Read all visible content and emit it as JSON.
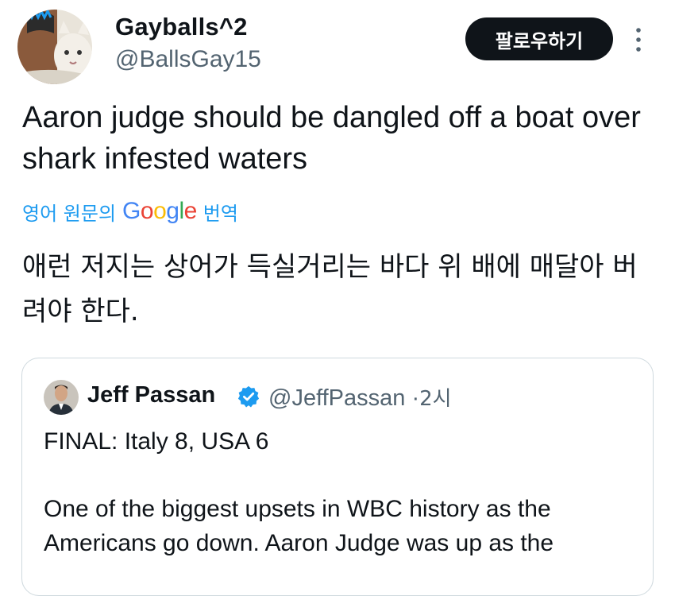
{
  "author": {
    "display_name": "Gayballs^2",
    "handle": "@BallsGay15"
  },
  "follow_button": {
    "label": "팔로우하기"
  },
  "more_icon": "vertical-ellipsis",
  "tweet": {
    "text": "Aaron judge should be dangled off a boat over shark infested waters"
  },
  "translation": {
    "prefix": "영어 원문의",
    "brand": [
      "G",
      "o",
      "o",
      "g",
      "l",
      "e"
    ],
    "suffix": "번역",
    "text": "애런 저지는 상어가 득실거리는 바다 위 배에 매달아 버려야 한다."
  },
  "quoted_tweet": {
    "author_name": "Jeff Passan",
    "verified_icon": "verified-badge",
    "handle": "@JeffPassan",
    "separator": "·",
    "time": "2시",
    "line1": "FINAL: Italy 8, USA 6",
    "body": "One of the biggest upsets in WBC history as the Americans go down. Aaron Judge was up as the"
  },
  "colors": {
    "accent": "#1d9bf0",
    "text": "#0f1419",
    "muted": "#536471",
    "border": "#cfd9de",
    "verified": "#1d9bf0"
  }
}
